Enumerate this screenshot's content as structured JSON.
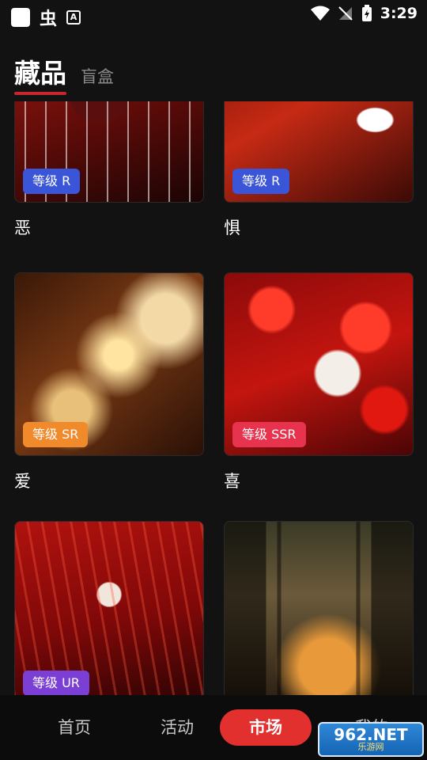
{
  "status_bar": {
    "app_glyph": "虫",
    "time": "3:29"
  },
  "header": {
    "active_tab": "藏品",
    "tab_2": "盲盒"
  },
  "cards": [
    {
      "title": "恶",
      "badge": "等级 R",
      "badge_color": "#3b55d9"
    },
    {
      "title": "惧",
      "badge": "等级 R",
      "badge_color": "#3b55d9"
    },
    {
      "title": "爱",
      "badge": "等级 SR",
      "badge_color": "#f08a2a"
    },
    {
      "title": "喜",
      "badge": "等级 SSR",
      "badge_color": "#e8334f"
    },
    {
      "title": "",
      "badge": "等级 UR",
      "badge_color": "#7b3fd6"
    },
    {
      "title": "",
      "badge": "",
      "badge_color": ""
    }
  ],
  "bottom_nav": {
    "items": [
      "首页",
      "活动",
      "市场",
      "我的"
    ],
    "active": "市场"
  },
  "watermark": {
    "top": "962.NET",
    "bottom": "乐游网"
  }
}
